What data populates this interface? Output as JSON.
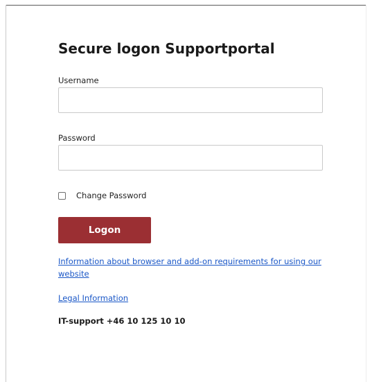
{
  "page": {
    "title": "Secure logon Supportportal"
  },
  "form": {
    "username_label": "Username",
    "username_value": "",
    "password_label": "Password",
    "password_value": "",
    "change_password_label": "Change Password",
    "change_password_checked": false,
    "logon_label": "Logon"
  },
  "links": {
    "requirements": "Information about browser and add-on requirements for using our website",
    "legal": "Legal Information"
  },
  "support": {
    "text": "IT-support +46 10 125 10 10"
  },
  "colors": {
    "button_background": "#9b2f33",
    "button_text": "#ffffff",
    "link": "#1a57c7",
    "input_border": "#c9c9c9"
  }
}
